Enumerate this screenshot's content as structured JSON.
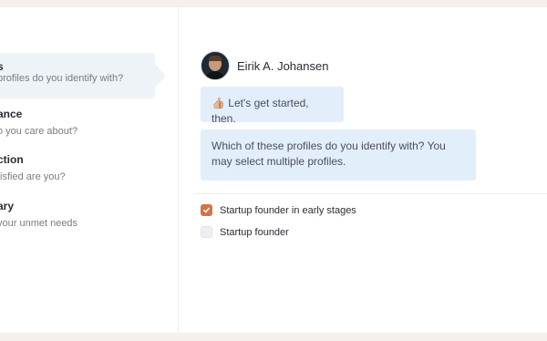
{
  "sidebar": {
    "steps": [
      {
        "title": "s",
        "subtitle": "profiles do you identify with?"
      },
      {
        "title": "ance",
        "subtitle": "o you care about?"
      },
      {
        "title": "ction",
        "subtitle": "tisfied are you?"
      },
      {
        "title": "ary",
        "subtitle": "your unmet needs"
      }
    ]
  },
  "chat": {
    "author": {
      "name": "Eirik A. Johansen"
    },
    "messages": [
      {
        "emoji": "👍🏼",
        "text": "Let's get started, then."
      },
      {
        "text": "Which of these profiles do you identify with? You may select multiple profiles."
      }
    ],
    "options": [
      {
        "label": "Startup founder in early stages",
        "checked": true
      },
      {
        "label": "Startup founder",
        "checked": false
      }
    ]
  },
  "colors": {
    "accent": "#d0764a",
    "bubble": "#e3eefb",
    "active_step_bg": "#eef3f8",
    "page_bg": "#f5f0eb"
  }
}
